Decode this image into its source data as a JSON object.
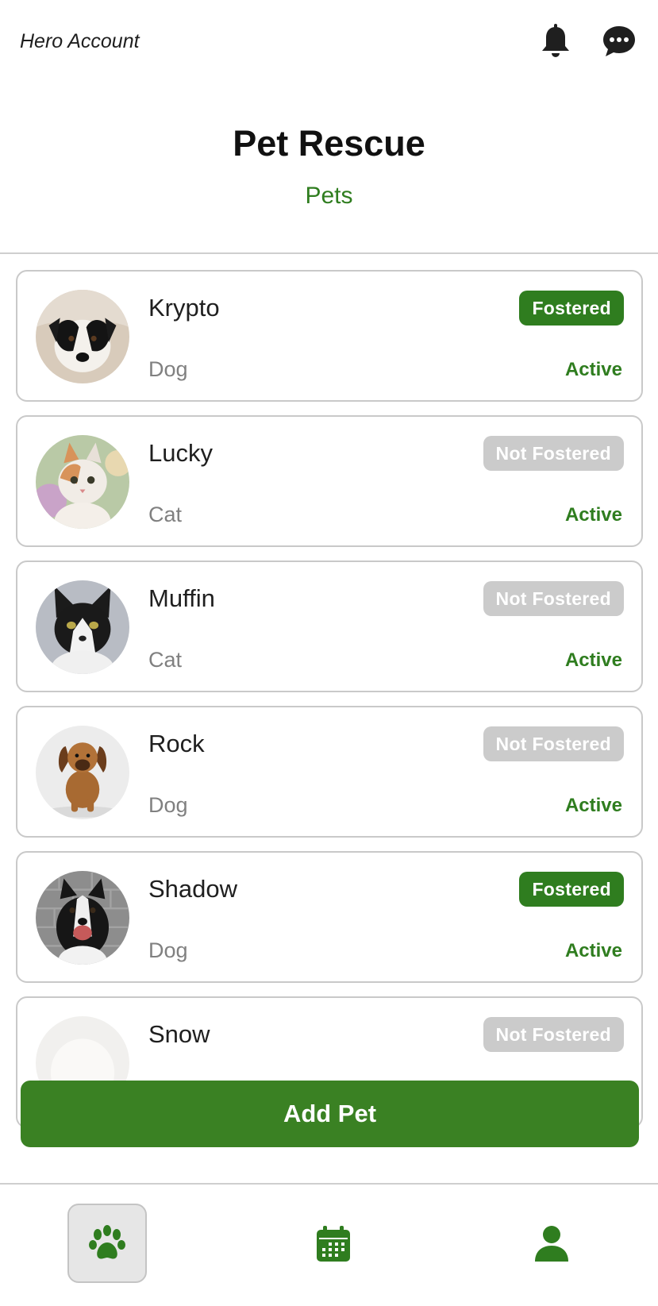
{
  "header": {
    "account_label": "Hero Account",
    "bell_icon": "bell-icon",
    "chat_icon": "chat-bubble-icon"
  },
  "title": "Pet Rescue",
  "subtitle": "Pets",
  "pets": [
    {
      "name": "Krypto",
      "type": "Dog",
      "foster": "Fostered",
      "status": "Active"
    },
    {
      "name": "Lucky",
      "type": "Cat",
      "foster": "Not Fostered",
      "status": "Active"
    },
    {
      "name": "Muffin",
      "type": "Cat",
      "foster": "Not Fostered",
      "status": "Active"
    },
    {
      "name": "Rock",
      "type": "Dog",
      "foster": "Not Fostered",
      "status": "Active"
    },
    {
      "name": "Shadow",
      "type": "Dog",
      "foster": "Fostered",
      "status": "Active"
    },
    {
      "name": "Snow",
      "type": "",
      "foster": "Not Fostered",
      "status": ""
    }
  ],
  "add_button_label": "Add Pet",
  "tabs": [
    {
      "icon": "paw-icon",
      "active": true
    },
    {
      "icon": "calendar-icon",
      "active": false
    },
    {
      "icon": "person-icon",
      "active": false
    }
  ],
  "colors": {
    "accent": "#2f7d1f",
    "button": "#3a8123",
    "badge_inactive": "#cbcbcb"
  }
}
